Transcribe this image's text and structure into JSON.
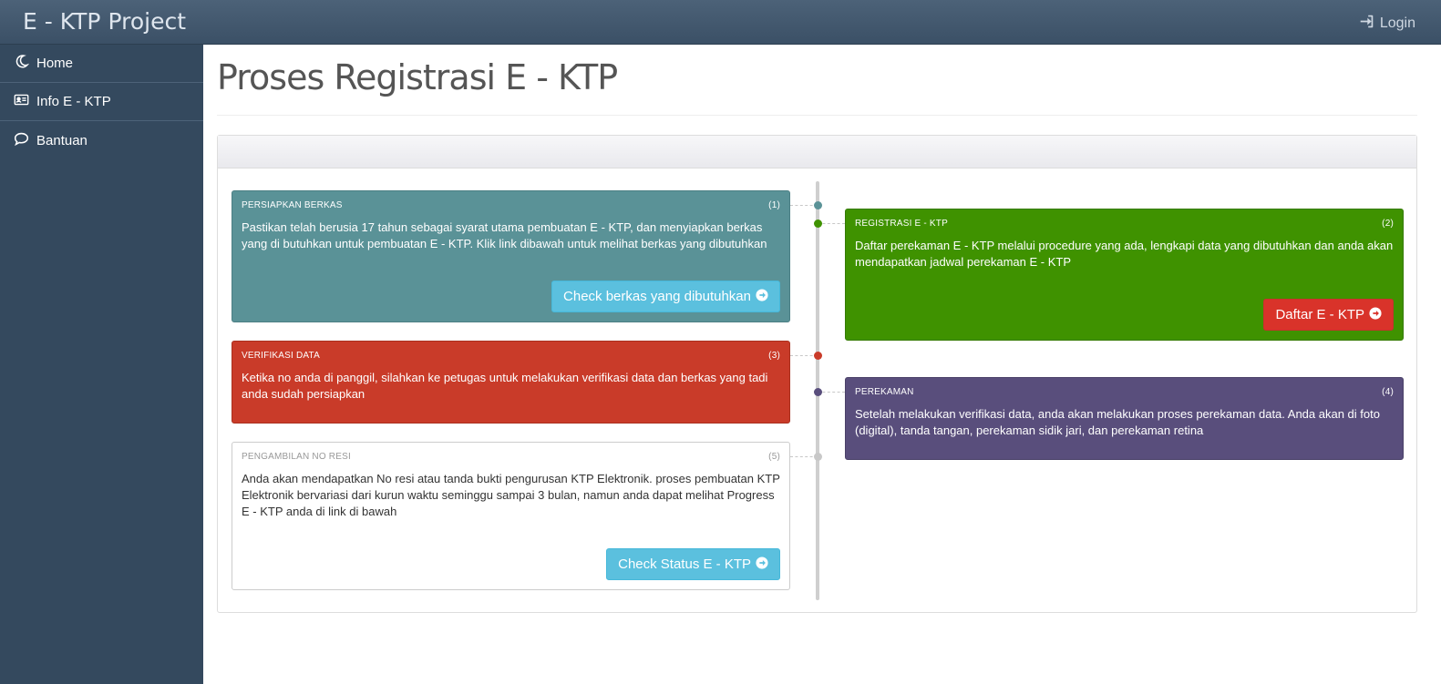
{
  "app": {
    "title": "E - KTP Project"
  },
  "header": {
    "login_label": "Login"
  },
  "sidebar": {
    "items": [
      {
        "label": "Home",
        "icon": "moon-icon"
      },
      {
        "label": "Info E - KTP",
        "icon": "id-card-icon"
      },
      {
        "label": "Bantuan",
        "icon": "chat-bubble-icon"
      }
    ]
  },
  "main": {
    "title": "Proses Registrasi E - KTP"
  },
  "timeline": {
    "steps": [
      {
        "title": "PERSIAPKAN BERKAS",
        "number": "(1)",
        "body": "Pastikan telah berusia 17 tahun sebagai syarat utama pembuatan E - KTP, dan menyiapkan berkas yang di butuhkan untuk pembuatan E - KTP. Klik link dibawah untuk melihat berkas yang dibutuhkan",
        "button": "Check berkas yang dibutuhkan",
        "color": "#5a9297"
      },
      {
        "title": "REGISTRASI E - KTP",
        "number": "(2)",
        "body": "Daftar perekaman E - KTP melalui procedure yang ada, lengkapi data yang dibutuhkan dan anda akan mendapatkan jadwal perekaman E - KTP",
        "button": "Daftar E - KTP",
        "color": "#3f9200"
      },
      {
        "title": "VERIFIKASI DATA",
        "number": "(3)",
        "body": "Ketika no anda di panggil, silahkan ke petugas untuk melakukan verifikasi data dan berkas yang tadi anda sudah persiapkan",
        "color": "#c93b29"
      },
      {
        "title": "PEREKAMAN",
        "number": "(4)",
        "body": "Setelah melakukan verifikasi data, anda akan melakukan proses perekaman data. Anda akan di foto (digital), tanda tangan, perekaman sidik jari, dan perekaman retina",
        "color": "#594e7c"
      },
      {
        "title": "PENGAMBILAN NO RESI",
        "number": "(5)",
        "body": "Anda akan mendapatkan No resi atau tanda bukti pengurusan KTP Elektronik. proses pembuatan KTP Elektronik bervariasi dari kurun waktu seminggu sampai 3 bulan, namun anda dapat melihat Progress E - KTP anda di link di bawah",
        "button": "Check Status E - KTP",
        "color": "#ffffff"
      }
    ]
  }
}
